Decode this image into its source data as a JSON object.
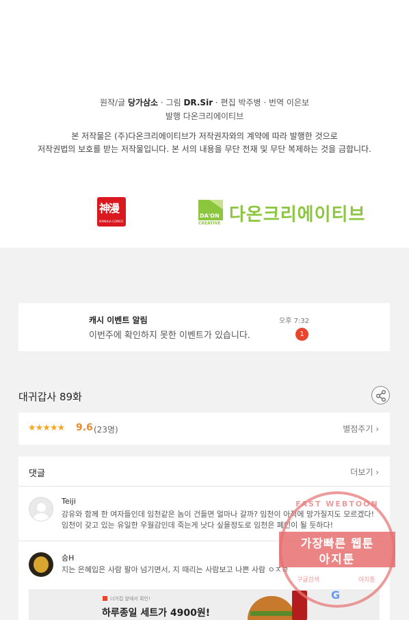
{
  "credits": {
    "line1_parts": [
      "원작/글 ",
      "당가삼소",
      " · 그림 ",
      "DR.Sir",
      " · 편집 박주병 · 번역 이은보"
    ],
    "line2": "발행 다온크리에이티브",
    "copyright1": "본 저작물은 (주)다온크리에이티브가 저작권자와의 계약에 따라 발행한 것으로",
    "copyright2": "저작권법의 보호를 받는 저작물입니다. 본 서의 내용을 무단 전재 및 무단 복제하는 것을 금합니다.",
    "logo_left": "神漫",
    "logo_left_small": "MANHUA COMICS",
    "logo_right_mark": "DA'ON",
    "logo_right_sub": "CREATIVE",
    "logo_right_text": "다온크리에이티브"
  },
  "notice": {
    "title": "캐시 이벤트 알림",
    "message": "이번주에 확인하지 못한 이벤트가 있습니다.",
    "time": "오후 7:32",
    "badge": "1"
  },
  "episode": {
    "title": "대귀갑사 89화",
    "share_icon": "share-icon"
  },
  "rating": {
    "stars": "★★★★★",
    "score": "9.6",
    "count": "(23명)",
    "rate_label": "별점주기 ›"
  },
  "comments": {
    "title": "댓글",
    "more_label": "더보기 ›",
    "items": [
      {
        "name": "Teiji",
        "text": "강유와 함께 한 여자들인데 임천같은 놈이 건들면 얼마나 갈까? 임천이 아직에 망가질지도 모르겠다! 임천이 갖고 있는 유일한 우월감인데 죽는게 낫다 싶을정도로 임천은 폐인이 될 듯하다!"
      },
      {
        "name": "승H",
        "text": "지는 은혜입은 사람 팔아 넘기면서, 지 때리는 사람보고 나쁜 사람 ㅇㅈㄹ"
      }
    ]
  },
  "ad": {
    "small": "너거집 앞에서 확인!",
    "headline": "하루종일 세트가 4900원!"
  },
  "watermark": {
    "ring_top": "FAST WEBTOON",
    "line1": "가장빠른 웹툰",
    "line2": "아지툰",
    "bottom_left": "구글검색",
    "bottom_right": "아지툰",
    "g": "G"
  }
}
